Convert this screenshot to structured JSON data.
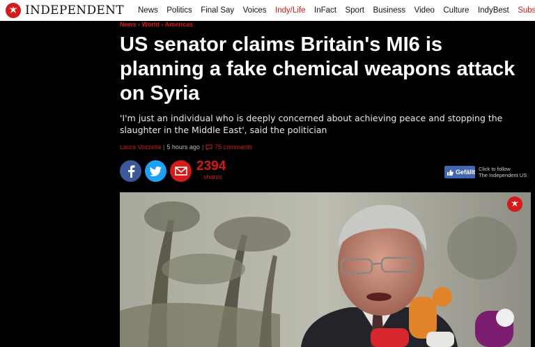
{
  "header": {
    "logo_text": "INDEPENDENT",
    "nav": [
      {
        "label": "News",
        "accent": false
      },
      {
        "label": "Politics",
        "accent": false
      },
      {
        "label": "Final Say",
        "accent": false
      },
      {
        "label": "Voices",
        "accent": false
      },
      {
        "label": "Indy/Life",
        "accent": true
      },
      {
        "label": "InFact",
        "accent": false
      },
      {
        "label": "Sport",
        "accent": false
      },
      {
        "label": "Business",
        "accent": false
      },
      {
        "label": "Video",
        "accent": false
      },
      {
        "label": "Culture",
        "accent": false
      },
      {
        "label": "IndyBest",
        "accent": false
      },
      {
        "label": "Subscribe",
        "accent": true
      }
    ]
  },
  "article": {
    "breadcrumb": [
      "News",
      "World",
      "Americas"
    ],
    "breadcrumb_sep": "›",
    "headline": "US senator claims Britain's MI6 is planning a fake chemical weapons attack on Syria",
    "standfirst": "'I'm just an individual who is deeply concerned about achieving peace and stopping the slaughter in the Middle East', said the politician",
    "author": "Laura Vozzella",
    "time": "5 hours ago",
    "comments": "75 comments",
    "byline_sep": "|"
  },
  "share": {
    "count": "2394",
    "label": "shares"
  },
  "follow": {
    "button": "Gefällt",
    "text_line1": "Click to follow",
    "text_line2": "The Independent US"
  },
  "colors": {
    "brand_red": "#d41a1a",
    "facebook": "#3b5998",
    "twitter": "#1da1f2"
  },
  "icons": [
    "eagle-logo-icon",
    "facebook-icon",
    "twitter-icon",
    "email-icon",
    "comment-icon",
    "thumbs-up-icon"
  ]
}
